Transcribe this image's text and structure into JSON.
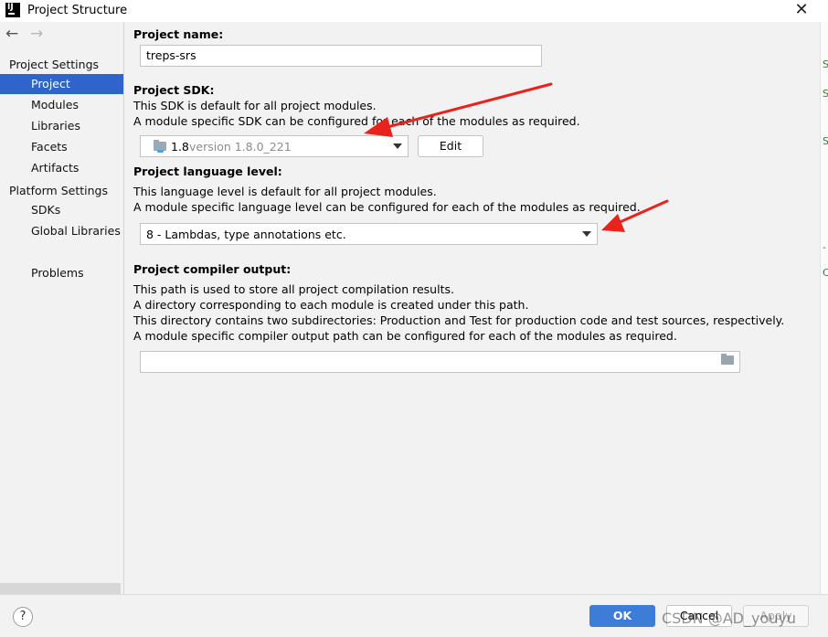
{
  "window": {
    "title": "Project Structure",
    "app_icon_text": "IJ"
  },
  "sidebar": {
    "nav": {
      "back_glyph": "←",
      "forward_glyph": "→"
    },
    "groups": [
      {
        "label": "Project Settings"
      },
      {
        "label": "Platform Settings"
      }
    ],
    "items": [
      {
        "label": "Project",
        "selected": true
      },
      {
        "label": "Modules"
      },
      {
        "label": "Libraries"
      },
      {
        "label": "Facets"
      },
      {
        "label": "Artifacts"
      },
      {
        "label": "SDKs"
      },
      {
        "label": "Global Libraries"
      },
      {
        "label": "Problems"
      }
    ]
  },
  "project_name": {
    "heading": "Project name:",
    "value": "treps-srs"
  },
  "project_sdk": {
    "heading": "Project SDK:",
    "desc1": "This SDK is default for all project modules.",
    "desc2": "A module specific SDK can be configured for each of the modules as required.",
    "selected_name": "1.8",
    "selected_version": "version 1.8.0_221",
    "edit_label": "Edit"
  },
  "language_level": {
    "heading": "Project language level:",
    "desc1": "This language level is default for all project modules.",
    "desc2": "A module specific language level can be configured for each of the modules as required.",
    "selected": "8 - Lambdas, type annotations etc."
  },
  "compiler_output": {
    "heading": "Project compiler output:",
    "desc1": "This path is used to store all project compilation results.",
    "desc2": "A directory corresponding to each module is created under this path.",
    "desc3": "This directory contains two subdirectories: Production and Test for production code and test sources, respectively.",
    "desc4": "A module specific compiler output path can be configured for each of the modules as required.",
    "path_value": ""
  },
  "footer": {
    "help_label": "?",
    "ok_label": "OK",
    "cancel_label": "Cancel",
    "apply_label": "Apply"
  },
  "watermark": "CSDN @AD_youyu",
  "annotation_color": "#e8231c",
  "selection_color": "#2f65ca",
  "ok_color": "#3d7dd8"
}
